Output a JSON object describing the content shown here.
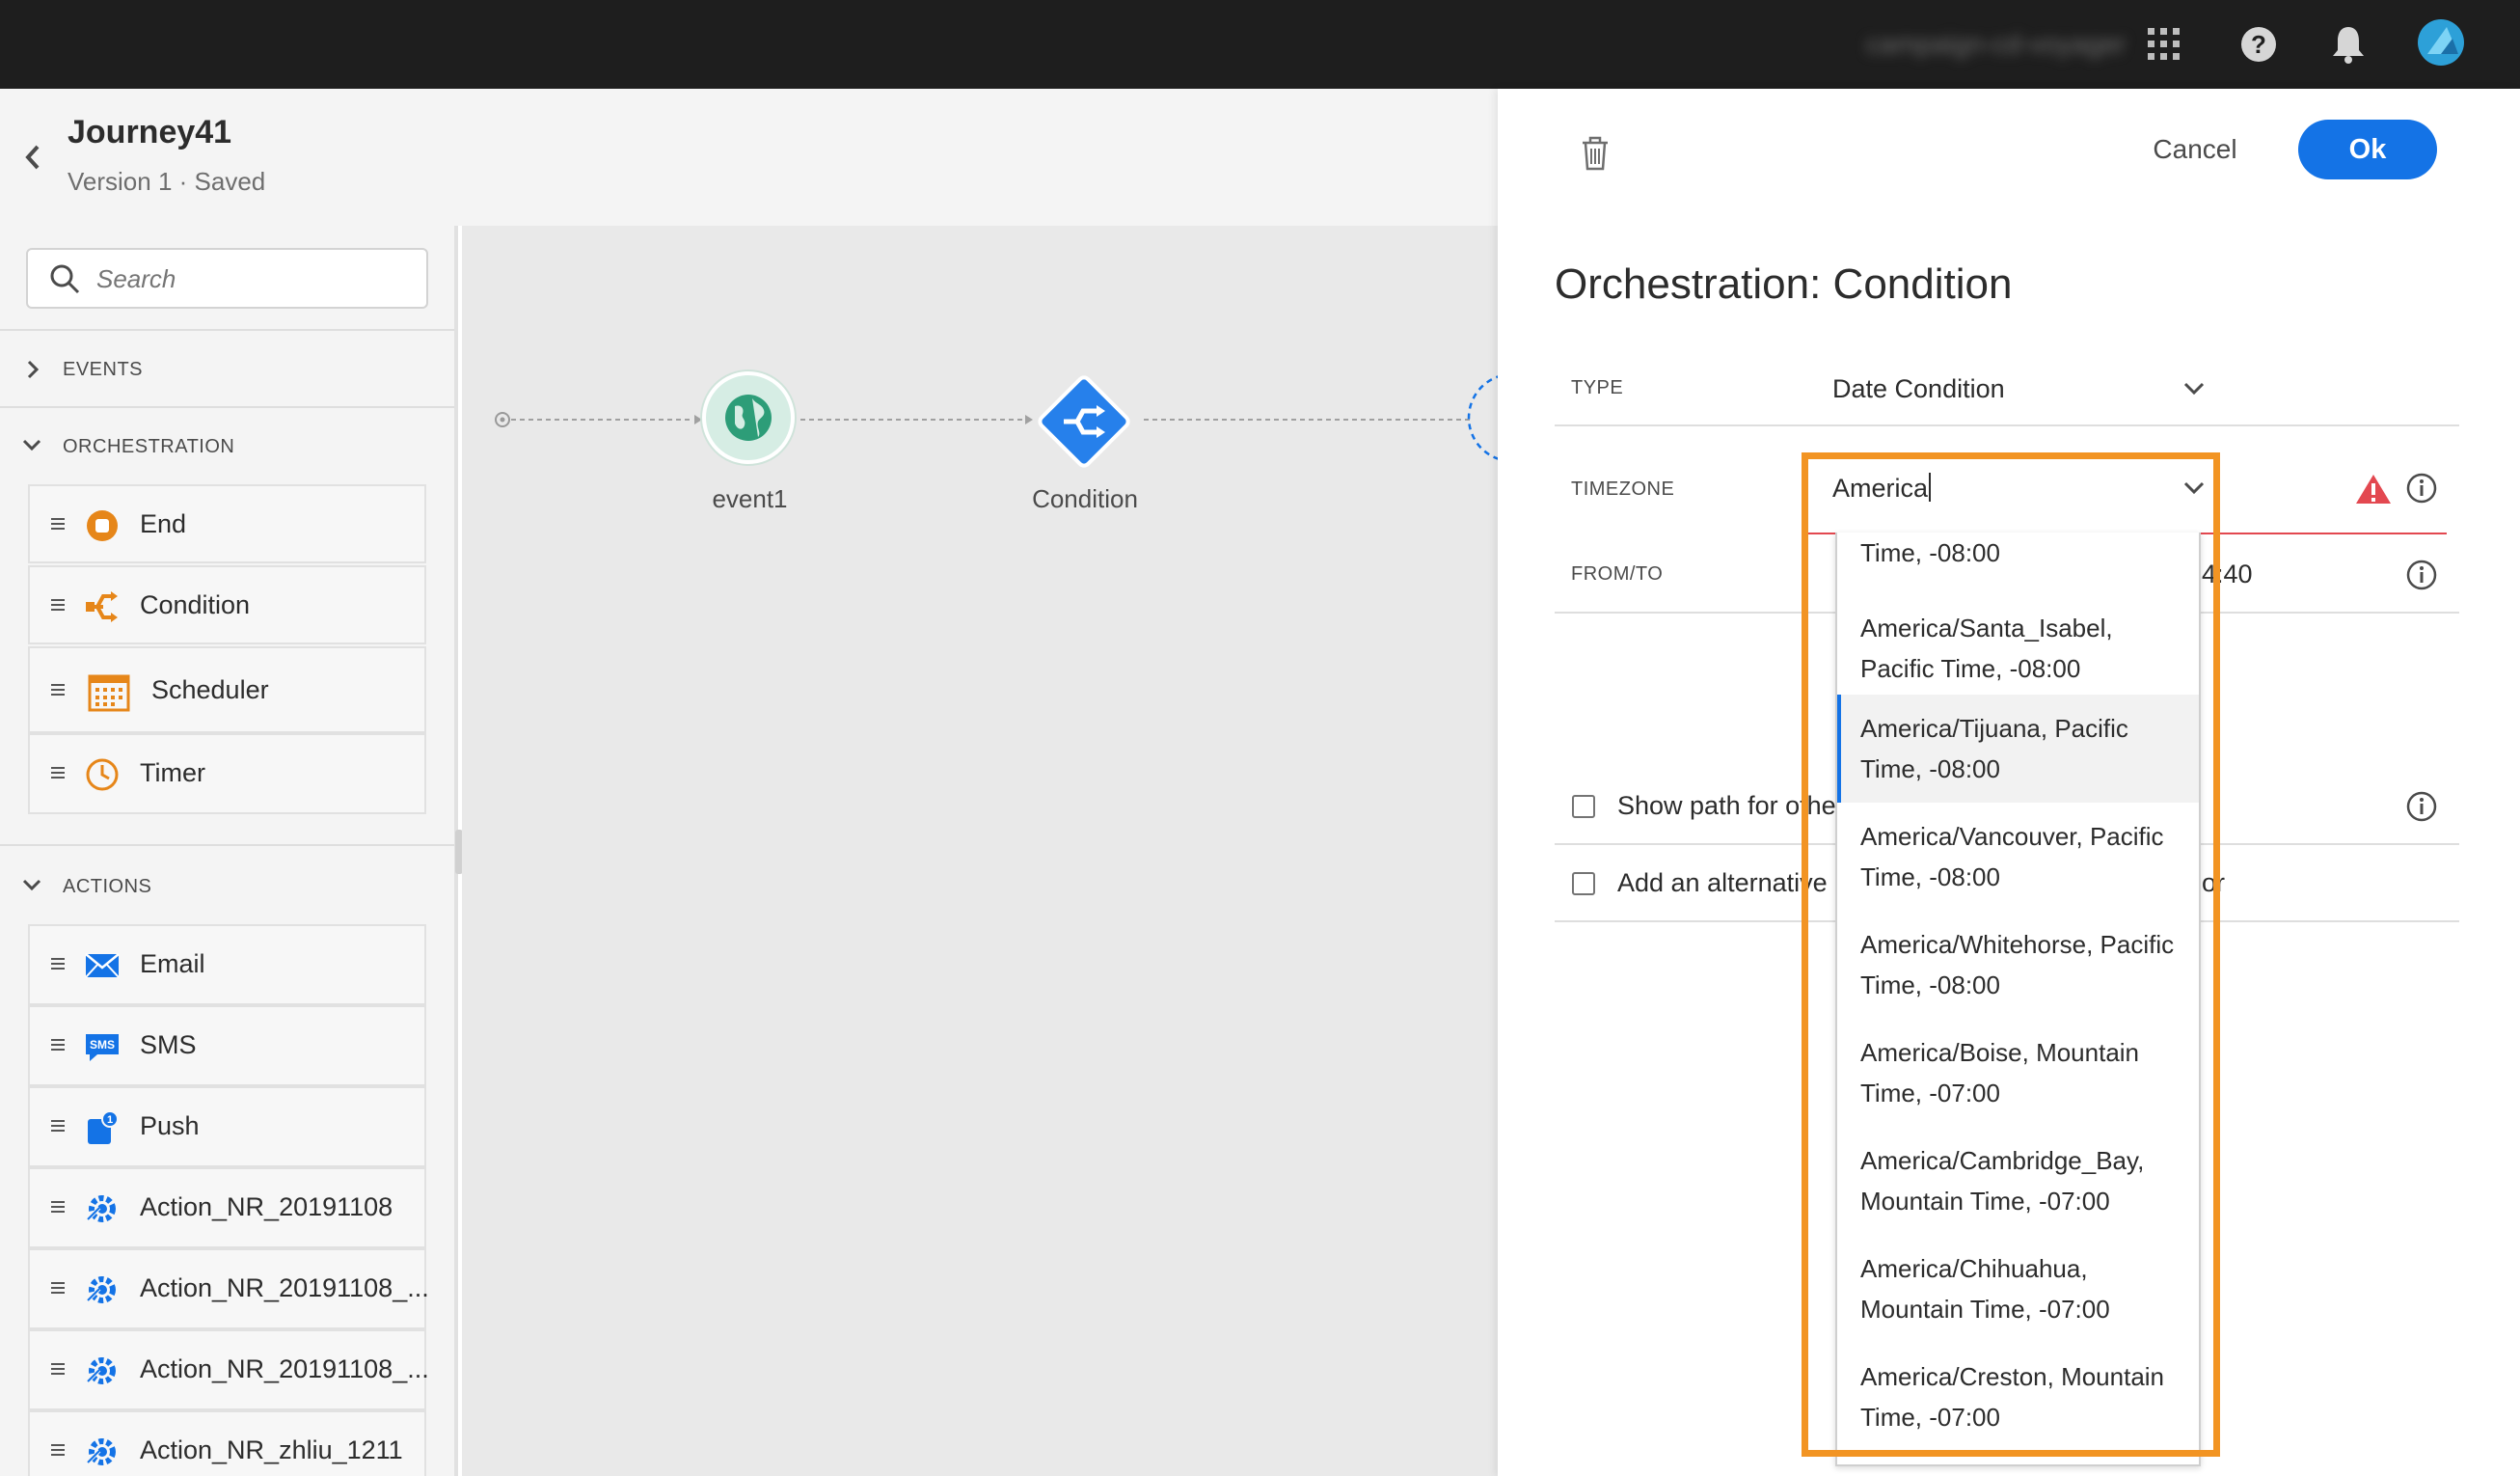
{
  "topbar": {
    "org_name": "campaign-cd-voyager",
    "icons": [
      "apps-icon",
      "help-icon",
      "bell-icon",
      "avatar"
    ]
  },
  "journey": {
    "title": "Journey41",
    "status": "Version 1 · Saved"
  },
  "palette": {
    "search_placeholder": "Search",
    "sections": {
      "events": "EVENTS",
      "orchestration": "ORCHESTRATION",
      "actions": "ACTIONS"
    },
    "orchestration_items": [
      {
        "label": "End",
        "icon": "end-icon"
      },
      {
        "label": "Condition",
        "icon": "condition-icon"
      },
      {
        "label": "Scheduler",
        "icon": "calendar-icon"
      },
      {
        "label": "Timer",
        "icon": "clock-icon"
      }
    ],
    "action_items": [
      {
        "label": "Email",
        "icon": "email-icon"
      },
      {
        "label": "SMS",
        "icon": "sms-icon"
      },
      {
        "label": "Push",
        "icon": "push-icon"
      },
      {
        "label": "Action_NR_20191108",
        "icon": "custom-action-icon"
      },
      {
        "label": "Action_NR_20191108_...",
        "icon": "custom-action-icon"
      },
      {
        "label": "Action_NR_20191108_...",
        "icon": "custom-action-icon"
      },
      {
        "label": "Action_NR_zhliu_1211",
        "icon": "custom-action-icon"
      }
    ]
  },
  "canvas": {
    "nodes": [
      {
        "label": "event1",
        "icon": "globe-icon"
      },
      {
        "label": "Condition",
        "icon": "condition-icon"
      }
    ]
  },
  "panel": {
    "cancel_label": "Cancel",
    "ok_label": "Ok",
    "title": "Orchestration: Condition",
    "type_label": "TYPE",
    "type_value": "Date Condition",
    "timezone_label": "TIMEZONE",
    "timezone_value": "America",
    "fromto_label": "FROM/TO",
    "fromto_value_partial": "4:40",
    "checkbox_show_path": "Show path for other",
    "checkbox_alternative_a": "Add an alternative p",
    "checkbox_alternative_b": "or"
  },
  "timezone_options": [
    {
      "line1": "Time, -08:00",
      "line2": "",
      "selected": false
    },
    {
      "line1": "America/Santa_Isabel,",
      "line2": "Pacific Time, -08:00",
      "selected": false
    },
    {
      "line1": "America/Tijuana, Pacific",
      "line2": "Time, -08:00",
      "selected": true
    },
    {
      "line1": "America/Vancouver, Pacific",
      "line2": "Time, -08:00",
      "selected": false
    },
    {
      "line1": "America/Whitehorse, Pacific",
      "line2": "Time, -08:00",
      "selected": false
    },
    {
      "line1": "America/Boise, Mountain",
      "line2": "Time, -07:00",
      "selected": false
    },
    {
      "line1": "America/Cambridge_Bay,",
      "line2": "Mountain Time, -07:00",
      "selected": false
    },
    {
      "line1": "America/Chihuahua,",
      "line2": "Mountain Time, -07:00",
      "selected": false
    },
    {
      "line1": "America/Creston, Mountain",
      "line2": "Time, -07:00",
      "selected": false
    }
  ],
  "colors": {
    "accent_blue": "#1473e6",
    "highlight_orange": "#f29423",
    "error_red": "#e34850",
    "orchestration_orange": "#e68619"
  }
}
